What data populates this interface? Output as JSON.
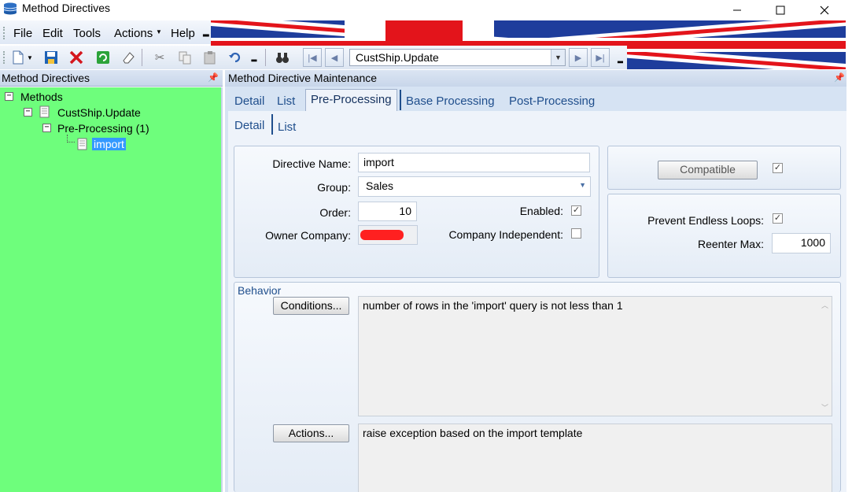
{
  "window": {
    "title": "Method Directives"
  },
  "menu": {
    "items": [
      "File",
      "Edit",
      "Tools",
      "Actions",
      "Help"
    ]
  },
  "toolbar": {
    "method_combo_value": "CustShip.Update"
  },
  "left_panel": {
    "title": "Method Directives",
    "tree": {
      "root": "Methods",
      "method": "CustShip.Update",
      "group": "Pre-Processing (1)",
      "directive": "import"
    }
  },
  "right_panel": {
    "title": "Method Directive Maintenance",
    "tabs": [
      "Detail",
      "List",
      "Pre-Processing",
      "Base Processing",
      "Post-Processing"
    ],
    "active_tab": "Pre-Processing",
    "subtabs": [
      "Detail",
      "List"
    ],
    "form": {
      "directive_name_label": "Directive Name:",
      "directive_name": "import",
      "group_label": "Group:",
      "group": "Sales",
      "order_label": "Order:",
      "order": "10",
      "enabled_label": "Enabled:",
      "enabled": true,
      "owner_company_label": "Owner Company:",
      "company_independent_label": "Company Independent:",
      "company_independent": false,
      "compatible_button": "Compatible",
      "compatible_checked": true,
      "prevent_endless_loops_label": "Prevent Endless Loops:",
      "prevent_endless_loops": true,
      "reenter_max_label": "Reenter Max:",
      "reenter_max": "1000"
    },
    "behavior": {
      "title": "Behavior",
      "conditions_button": "Conditions...",
      "conditions_text": "number of rows in the 'import' query is not less than 1",
      "actions_button": "Actions...",
      "actions_text": "raise exception based on the import template"
    }
  },
  "colors": {
    "tree_background": "#6efe7c",
    "selection": "#3399ff",
    "tab_text": "#1f4e8c"
  }
}
